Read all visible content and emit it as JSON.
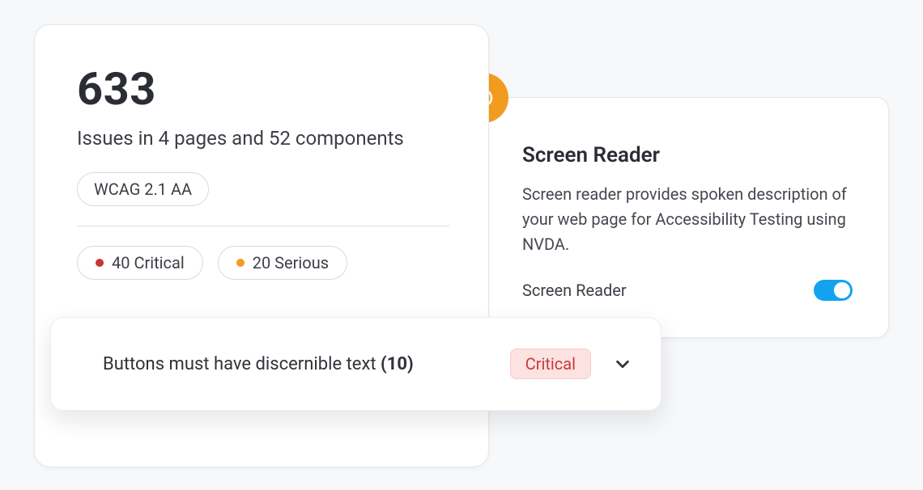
{
  "issues_card": {
    "count": "633",
    "description": "Issues in 4 pages and 52 components",
    "compliance_tag": "WCAG 2.1 AA",
    "severities": [
      {
        "label": "40 Critical",
        "dot_class": "dot-critical"
      },
      {
        "label": "20 Serious",
        "dot_class": "dot-serious"
      }
    ]
  },
  "issue_row": {
    "text": "Buttons must have discernible text ",
    "count": "(10)",
    "badge": "Critical"
  },
  "screen_reader": {
    "title": "Screen Reader",
    "description": "Screen reader provides spoken description of your web page for Accessibility Testing using NVDA.",
    "toggle_label": "Screen Reader",
    "toggle_on": true
  },
  "colors": {
    "orange": "#f29c1f",
    "critical": "#c7372f",
    "toggle_blue": "#12a3f0"
  }
}
